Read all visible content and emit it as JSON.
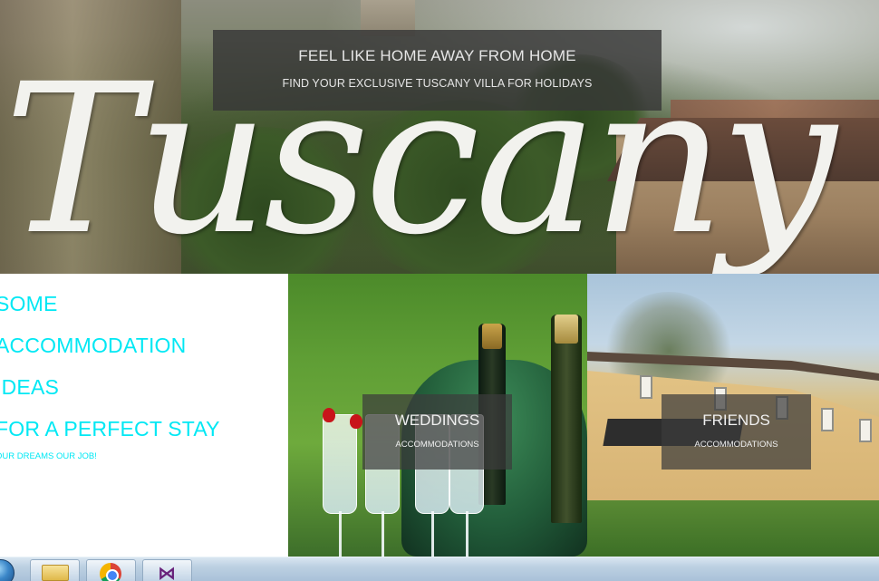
{
  "hero": {
    "banner_title": "FEEL LIKE HOME AWAY FROM HOME",
    "banner_subtitle": "FIND YOUR EXCLUSIVE TUSCANY VILLA FOR HOLIDAYS",
    "logo_text": "Tuscany"
  },
  "left_panel": {
    "lines": [
      "SOME",
      "ACCOMMODATION",
      "IDEAS",
      "FOR A PERFECT STAY"
    ],
    "tagline": "OUR DREAMS OUR JOB!"
  },
  "tiles": [
    {
      "title": "WEDDINGS",
      "subtitle": "ACCOMMODATIONS"
    },
    {
      "title": "FRIENDS",
      "subtitle": "ACCOMMODATIONS"
    }
  ],
  "taskbar": {
    "items": [
      "start-orb",
      "file-explorer-icon",
      "chrome-icon",
      "visual-studio-icon"
    ]
  },
  "colors": {
    "accent_text": "#00e8f4",
    "banner_bg": "#373737"
  }
}
